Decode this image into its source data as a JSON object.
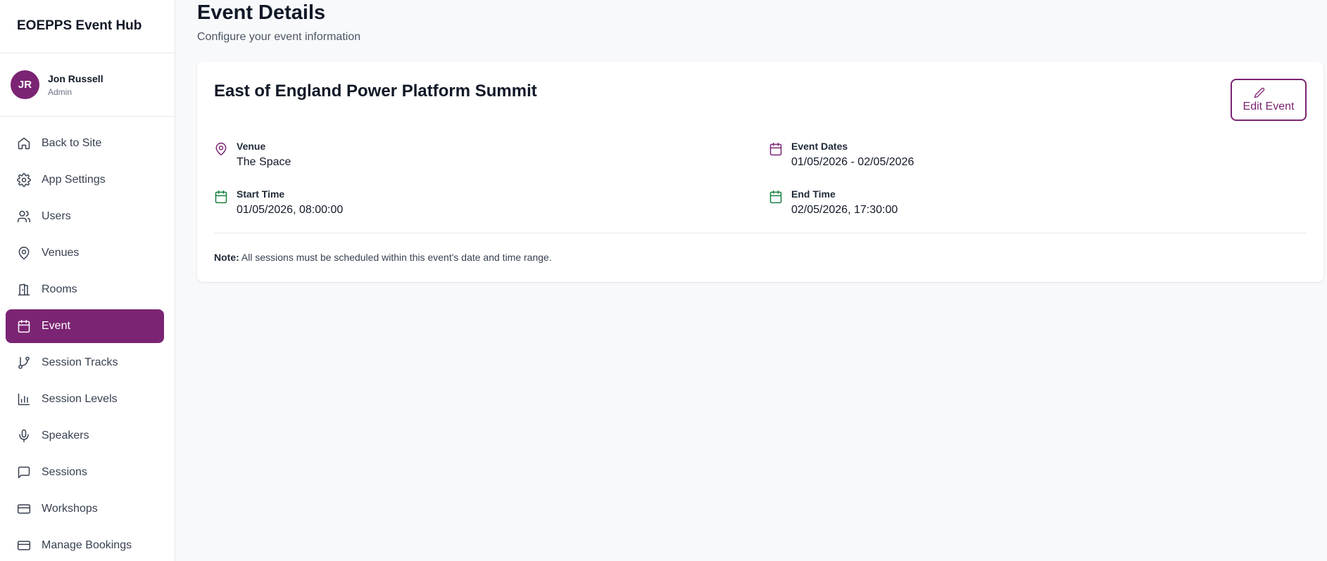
{
  "app": {
    "title": "EOEPPS Event Hub"
  },
  "user": {
    "initials": "JR",
    "name": "Jon Russell",
    "role": "Admin"
  },
  "colors": {
    "accent": "#7b2473",
    "green_icon": "#15803d"
  },
  "sidebar": {
    "items": [
      {
        "label": "Back to Site",
        "icon": "home-icon",
        "active": false
      },
      {
        "label": "App Settings",
        "icon": "gear-icon",
        "active": false
      },
      {
        "label": "Users",
        "icon": "users-icon",
        "active": false
      },
      {
        "label": "Venues",
        "icon": "map-pin-icon",
        "active": false
      },
      {
        "label": "Rooms",
        "icon": "door-icon",
        "active": false
      },
      {
        "label": "Event",
        "icon": "calendar-icon",
        "active": true
      },
      {
        "label": "Session Tracks",
        "icon": "git-branch-icon",
        "active": false
      },
      {
        "label": "Session Levels",
        "icon": "bar-chart-icon",
        "active": false
      },
      {
        "label": "Speakers",
        "icon": "mic-icon",
        "active": false
      },
      {
        "label": "Sessions",
        "icon": "message-icon",
        "active": false
      },
      {
        "label": "Workshops",
        "icon": "card-icon",
        "active": false
      },
      {
        "label": "Manage Bookings",
        "icon": "card-icon",
        "active": false
      }
    ]
  },
  "main": {
    "title": "Event Details",
    "subtitle": "Configure your event information",
    "card": {
      "event_name": "East of England Power Platform Summit",
      "edit_label": "Edit Event",
      "venue_label": "Venue",
      "venue_value": "The Space",
      "dates_label": "Event Dates",
      "dates_value": "01/05/2026 - 02/05/2026",
      "start_label": "Start Time",
      "start_value": "01/05/2026, 08:00:00",
      "end_label": "End Time",
      "end_value": "02/05/2026, 17:30:00",
      "note_bold": "Note:",
      "note_text": "All sessions must be scheduled within this event's date and time range."
    }
  }
}
